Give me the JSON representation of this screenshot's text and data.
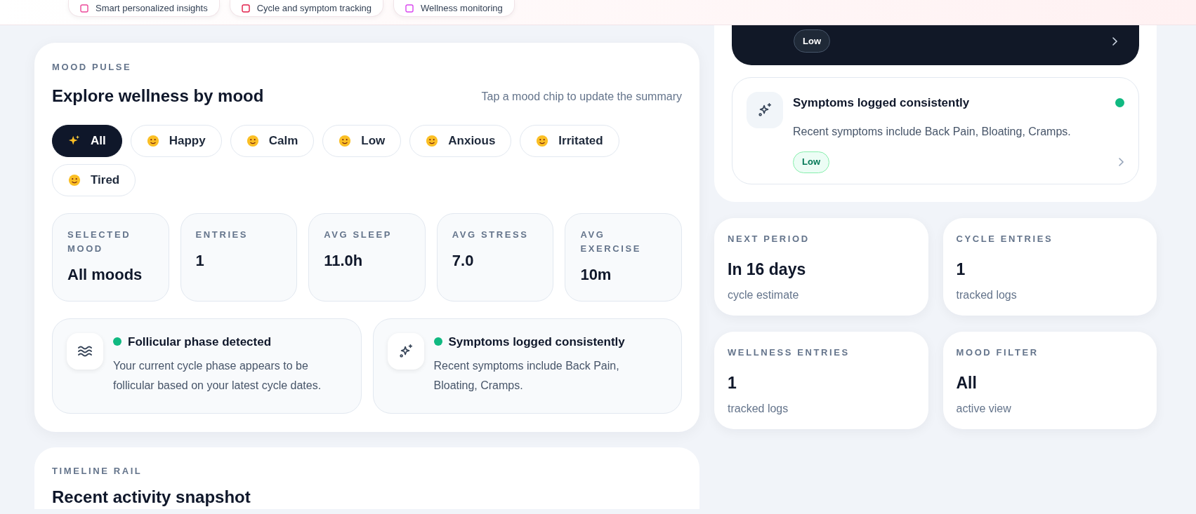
{
  "feature_chips": [
    "Smart personalized insights",
    "Cycle and symptom tracking",
    "Wellness monitoring"
  ],
  "mood_pulse": {
    "eyebrow": "MOOD PULSE",
    "title": "Explore wellness by mood",
    "hint": "Tap a mood chip to update the summary",
    "moods": [
      {
        "label": "All",
        "kind": "sparkle",
        "selected": true
      },
      {
        "label": "Happy",
        "kind": "face",
        "selected": false
      },
      {
        "label": "Calm",
        "kind": "face",
        "selected": false
      },
      {
        "label": "Low",
        "kind": "face",
        "selected": false
      },
      {
        "label": "Anxious",
        "kind": "face",
        "selected": false
      },
      {
        "label": "Irritated",
        "kind": "face",
        "selected": false
      },
      {
        "label": "Tired",
        "kind": "face",
        "selected": false
      }
    ],
    "stats": [
      {
        "label": "SELECTED MOOD",
        "value": "All moods"
      },
      {
        "label": "ENTRIES",
        "value": "1"
      },
      {
        "label": "AVG SLEEP",
        "value": "11.0h"
      },
      {
        "label": "AVG STRESS",
        "value": "7.0"
      },
      {
        "label": "AVG EXERCISE",
        "value": "10m"
      }
    ],
    "insights": [
      {
        "kind": "waves",
        "title": "Follicular phase detected",
        "text": "Your current cycle phase appears to be follicular based on your latest cycle dates."
      },
      {
        "kind": "sparkle",
        "title": "Symptoms logged consistently",
        "text": "Recent symptoms include Back Pain, Bloating, Cramps."
      }
    ]
  },
  "timeline": {
    "eyebrow": "TIMELINE RAIL",
    "title": "Recent activity snapshot"
  },
  "side_insights": [
    {
      "kind": "dark",
      "badge": "Low"
    },
    {
      "kind": "light",
      "title": "Symptoms logged consistently",
      "text": "Recent symptoms include Back Pain, Bloating, Cramps.",
      "badge": "Low"
    }
  ],
  "summary_cards": [
    {
      "label": "NEXT PERIOD",
      "value": "In 16 days",
      "note": "cycle estimate"
    },
    {
      "label": "CYCLE ENTRIES",
      "value": "1",
      "note": "tracked logs"
    },
    {
      "label": "WELLNESS ENTRIES",
      "value": "1",
      "note": "tracked logs"
    },
    {
      "label": "MOOD FILTER",
      "value": "All",
      "note": "active view"
    }
  ]
}
